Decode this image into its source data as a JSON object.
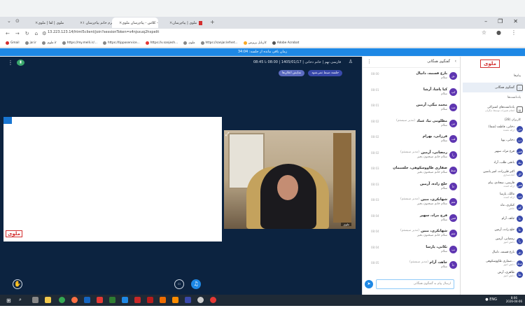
{
  "browser": {
    "tabs": [
      {
        "label": "ملوی | لقا | ملوی",
        "active": false
      },
      {
        "label": "ملوی - ملوی - ترم خانم پیام‌رسان ۱",
        "active": false
      },
      {
        "label": "ملوی - کلاس - پیام‌رسان ملوی",
        "active": true
      },
      {
        "label": "ملوی | پیام‌رسان",
        "active": false
      }
    ],
    "address": "13.223.123.14/html5client/join?sessionToken=s4njsxuq2hxpelit",
    "bookmarks": [
      "Gmail",
      "jar.ir",
      "ملوی.ir",
      "https://my.melli.ir/...",
      "https://tipposervice...",
      "https://v.sanjesh...",
      "ملوی",
      "https://sanjar.lefnet...",
      "کارتابل پرپرس",
      "Adobe Acrobat"
    ]
  },
  "timer": "زمان باقی مانده از جلسه: 34:04",
  "stage": {
    "session_title": "فارسی نهم | خانم دخانی | 1405/01/17 | 08:00 تا 08:45",
    "pill_left": "جلسه ضبط نمی‌شود",
    "pill_right": "نمایش اعلان‌ها",
    "presenter_name": "ملوی",
    "share_logo": "ملوی"
  },
  "chat": {
    "title": "گفتگوی همگانی",
    "input_placeholder": "ارسال پیام به گفتگوی همگانی",
    "messages": [
      {
        "name": "بازع قسمه، دانیال",
        "role": "",
        "time": "08:00",
        "text": "سلام",
        "initial": "بق"
      },
      {
        "name": "کیا پاشا، آرشا",
        "role": "",
        "time": "08:01",
        "text": "سلام",
        "initial": "کپ"
      },
      {
        "name": "محمد بیگی، آرمین",
        "role": "",
        "time": "08:01",
        "text": "سلام",
        "initial": "مب"
      },
      {
        "name": "مطلومی نیا، عماد",
        "role": "(مدیر سیستم)",
        "time": "08:02",
        "text": "سلام",
        "initial": "من"
      },
      {
        "name": "فرزانی، بهرام",
        "role": "",
        "time": "08:02",
        "text": "سلام",
        "initial": "فب"
      },
      {
        "name": "رمضانی، آرمین",
        "role": "(مدیر سیستم)",
        "time": "08:02",
        "text": "سلام خانم صبحتون بخیر",
        "initial": "رآ"
      },
      {
        "name": "صفاری طاووسکوهی، جلسیمان",
        "role": "",
        "time": "08:03",
        "text": "سلام خانم صبحتون بخیر",
        "initial": "صط"
      },
      {
        "name": "خلج زاده، آرمین",
        "role": "",
        "time": "08:03",
        "text": "سلام",
        "initial": "خآ"
      },
      {
        "name": "شهابکری، مبین",
        "role": "(مدیر سیستم)",
        "time": "08:03",
        "text": "سلام خانم صبحتون بخیر",
        "initial": "شم"
      },
      {
        "name": "فرج مراد، سهیر",
        "role": "",
        "time": "08:04",
        "text": "سلام",
        "initial": "فس"
      },
      {
        "name": "شهابکری، مبین",
        "role": "(مدیر سیستم)",
        "time": "08:04",
        "text": "سلام خانم صبحتون بخیر",
        "initial": "شم"
      },
      {
        "name": "نکانی، پارسا",
        "role": "",
        "time": "08:04",
        "text": "سلام",
        "initial": "نپ"
      },
      {
        "name": "جاهد، آرام",
        "role": "(مدیر سیستم)",
        "time": "08:05",
        "text": "سلام",
        "initial": "جآ"
      }
    ]
  },
  "sidebar": {
    "brand": "ملوی",
    "section_messages": "پیام‌ها",
    "public_chat": "گفتگوی همگانی",
    "section_notes": "یادداشت‌ها",
    "notes_item": "یادداشت‌های اشتراکی",
    "notes_sub": "انجام تغییرات توسط دیگران",
    "section_users": "کاربران (28)",
    "users": [
      {
        "name": "دخانی، فاطمه (شما)",
        "sub": "ارائه دهنده",
        "initial": "دف"
      },
      {
        "name": "دخانی، پویا",
        "sub": "",
        "initial": "دپ"
      },
      {
        "name": "فرج مراد، سهیر",
        "sub": "",
        "initial": "فس"
      },
      {
        "name": "بانجی طلب، آراد",
        "sub": "",
        "initial": "بط"
      },
      {
        "name": "اکبر قلی‌زاده، امیر یاسین",
        "sub": "آماده‌سازی",
        "initial": "اق"
      },
      {
        "name": "فارسی، سجادی، پیام",
        "sub": "ارائه کننده",
        "initial": "فس"
      },
      {
        "name": "مالک، پارسا",
        "sub": "ارائه کننده",
        "initial": "مپ"
      },
      {
        "name": "کنکری، ماه",
        "sub": "حاضر",
        "initial": "کم"
      },
      {
        "name": "جاهد، آرام",
        "sub": "",
        "initial": "جآ"
      },
      {
        "name": "خلج زاده، آرمین",
        "sub": "",
        "initial": "خآ"
      },
      {
        "name": "رمضانی، آرمین",
        "sub": "دانش آموز",
        "initial": "رآ"
      },
      {
        "name": "بازع قسمه، دانیال",
        "sub": "",
        "initial": "بق"
      },
      {
        "name": "صفاری طاووسکوهی...",
        "sub": "دانش آموز",
        "initial": "صط"
      },
      {
        "name": "طاهری، آرش",
        "sub": "دانش آموز",
        "initial": "طآ"
      }
    ]
  },
  "taskbar": {
    "time": "8:06",
    "date": "2026-04-06",
    "lang": "ENG"
  },
  "colors": {
    "accent": "#1e88e5",
    "stage_bg": "#0c2340",
    "brand_red": "#d32f2f",
    "avatar": "#5e35b1"
  }
}
